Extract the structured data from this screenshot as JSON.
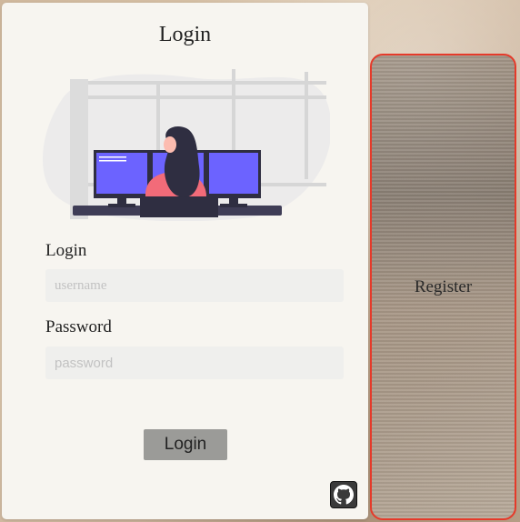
{
  "login_form": {
    "title": "Login",
    "username_label": "Login",
    "username_placeholder": "username",
    "password_label": "Password",
    "password_placeholder": "password",
    "submit_label": "Login",
    "github_icon": "github-icon"
  },
  "register_panel": {
    "label": "Register"
  },
  "colors": {
    "card_bg": "#f7f5f0",
    "button_bg": "#9b9b98",
    "register_border": "#e53a2a",
    "monitor_screen": "#6c63ff",
    "shirt": "#f26b79"
  }
}
